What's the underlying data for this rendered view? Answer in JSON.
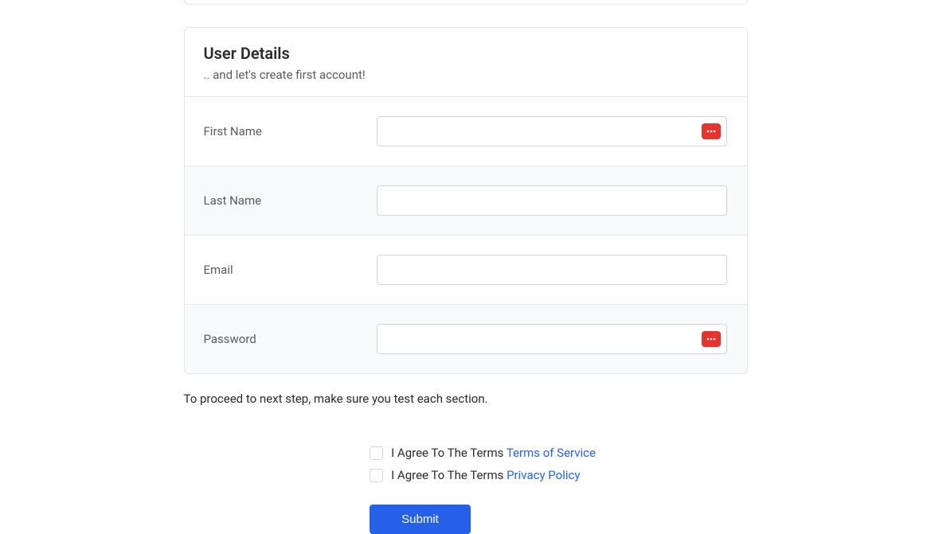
{
  "card": {
    "title": "User Details",
    "subtitle": ".. and let's create first account!"
  },
  "fields": {
    "first_name": {
      "label": "First Name",
      "value": ""
    },
    "last_name": {
      "label": "Last Name",
      "value": ""
    },
    "email": {
      "label": "Email",
      "value": ""
    },
    "password": {
      "label": "Password",
      "value": ""
    }
  },
  "hint": "To proceed to next step, make sure you test each section.",
  "agreements": {
    "tos": {
      "prefix": "I Agree To The Terms ",
      "link_text": "Terms of Service"
    },
    "privacy": {
      "prefix": "I Agree To The Terms ",
      "link_text": "Privacy Policy"
    }
  },
  "submit_label": "Submit",
  "colors": {
    "primary": "#2461e8",
    "badge": "#e5342e",
    "link": "#2563eb"
  }
}
